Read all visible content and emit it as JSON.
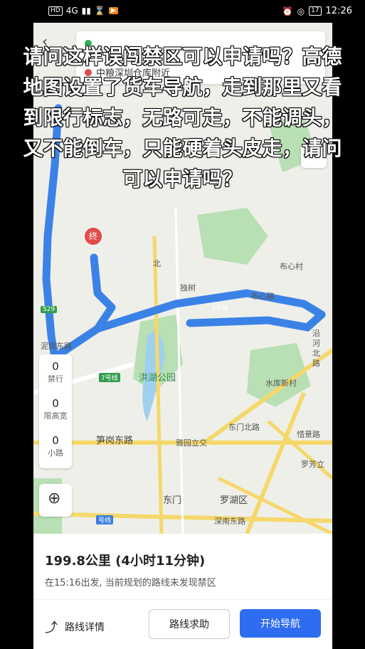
{
  "status_bar": {
    "left_chips": [
      "HD",
      "4G",
      "▮▮"
    ],
    "right_icons": [
      "alarm-icon",
      "location-icon"
    ],
    "battery": "17",
    "time": "12:26"
  },
  "search": {
    "destination": "中粮深圳仓库附近"
  },
  "map": {
    "labels": {
      "bu_xin_cun": "布心村",
      "du_shu": "独树",
      "bu_xin_lu": "布心路",
      "line3": "3号线",
      "yan_he_bei_lu": "沿河北路",
      "hong_hu_gong_yuan": "洪湖公园",
      "shui_ku_xin_cun": "水库新村",
      "sun_gang_dong_lu": "笋岗东路",
      "ya_yuan_li_jiao": "雅园立交",
      "dong_men_bei_lu": "东门北路",
      "xie_jing_lu": "惜景路",
      "luo_fang_li": "罗芳立",
      "dong_men": "东门",
      "luo_hu_qu": "罗湖区",
      "shen_nan_dong_lu": "深南东路",
      "line7": "7号线",
      "road_s29": "S29",
      "ni_gang_dong_lu": "泥岗东路",
      "bei": "北",
      "luo_dong_lu": "路罗路",
      "line_small": "号线",
      "end": "终"
    }
  },
  "side_panel": {
    "items": [
      {
        "value": "0",
        "label": "禁行"
      },
      {
        "value": "0",
        "label": "限高宽"
      },
      {
        "value": "0",
        "label": "小路"
      }
    ]
  },
  "route": {
    "distance": "199.8公里 (4小时11分钟)",
    "info": "在15:16出发, 当前规划的路线未发现禁区"
  },
  "actions": {
    "details": "路线详情",
    "help": "路线求助",
    "start": "开始导航"
  },
  "overlay": {
    "caption": "请问这样误闯禁区可以申请吗？高德地图设置了货车导航，走到那里又看到限行标志，无路可走，不能调头，又不能倒车，只能硬着头皮走，请问可以申请吗？"
  },
  "colors": {
    "route_blue": "#3b82e6",
    "road_yellow": "#f5d86b",
    "park_green": "#b9dfb4",
    "start_button": "#2f6df0"
  }
}
